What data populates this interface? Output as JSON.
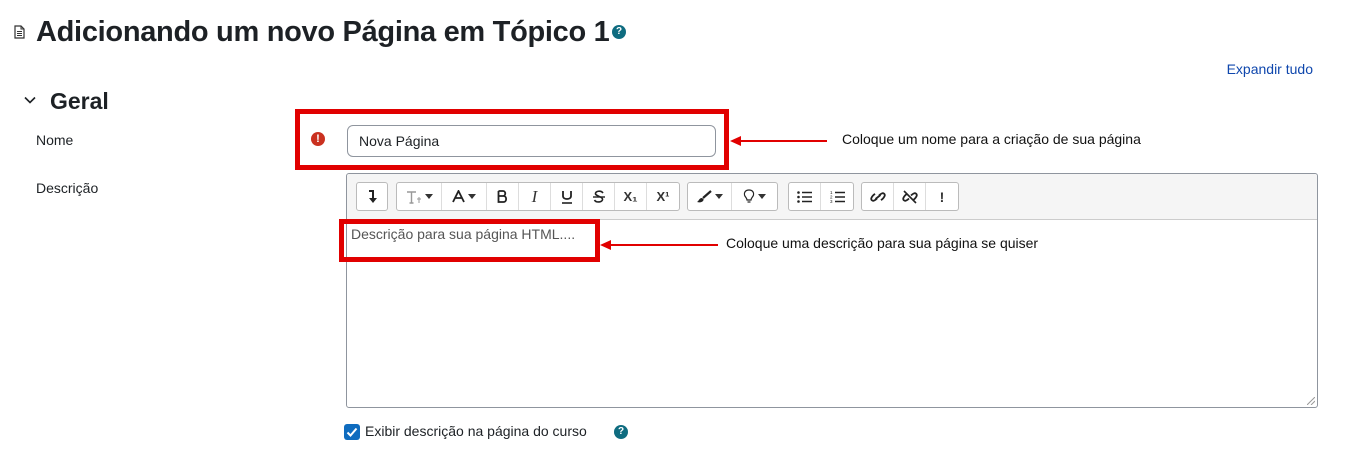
{
  "header": {
    "title": "Adicionando um novo Página em Tópico 1",
    "help_glyph": "?",
    "expand_all": "Expandir tudo"
  },
  "section": {
    "title": "Geral"
  },
  "fields": {
    "name": {
      "label": "Nome",
      "value": "Nova Página",
      "required_glyph": "!"
    },
    "description": {
      "label": "Descrição",
      "content": "Descrição para sua página HTML...."
    }
  },
  "toolbar": {
    "italic": "I",
    "subscript": "X₁",
    "superscript": "X¹",
    "accessibility": "!"
  },
  "annotations": {
    "name_note": "Coloque um nome para a criação de sua página",
    "desc_note": "Coloque uma descrição para sua página se quiser"
  },
  "checkbox": {
    "label": "Exibir descrição na página do curso",
    "checked": true,
    "help_glyph": "?"
  },
  "colors": {
    "link": "#0f47ad",
    "required": "#ca3120",
    "annotation_red": "#e10000",
    "checkbox": "#0f6cbf"
  }
}
